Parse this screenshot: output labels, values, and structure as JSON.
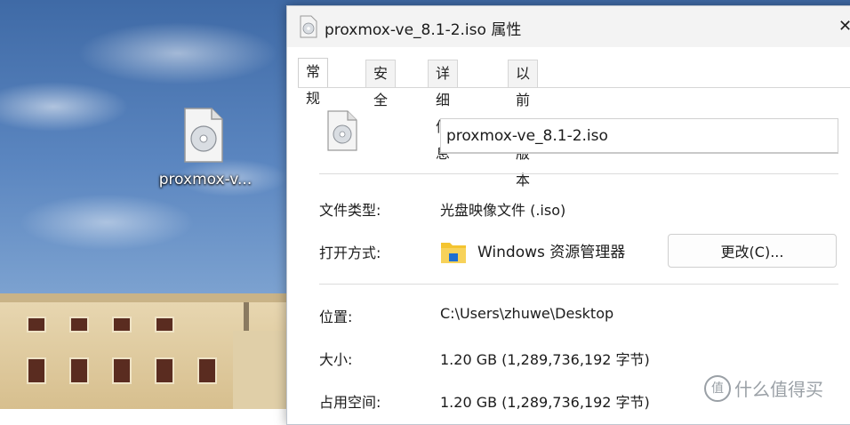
{
  "desktop": {
    "icon_label": "proxmox-v..."
  },
  "dialog": {
    "title": "proxmox-ve_8.1-2.iso 属性",
    "close_glyph": "✕",
    "tabs": [
      "常规",
      "安全",
      "详细信息",
      "以前的版本"
    ],
    "active_tab": "常规",
    "filename": "proxmox-ve_8.1-2.iso",
    "rows": {
      "file_type": {
        "label": "文件类型:",
        "value": "光盘映像文件 (.iso)"
      },
      "opens_with": {
        "label": "打开方式:",
        "app": "Windows 资源管理器",
        "button": "更改(C)..."
      },
      "location": {
        "label": "位置:",
        "value": "C:\\Users\\zhuwe\\Desktop"
      },
      "size": {
        "label": "大小:",
        "value": "1.20 GB (1,289,736,192 字节)"
      },
      "size_on_disk": {
        "label": "占用空间:",
        "value": "1.20 GB (1,289,736,192 字节)"
      }
    }
  },
  "watermark": {
    "mark": "值",
    "text": "什么值得买"
  },
  "icons": {
    "file": "disc-file-icon",
    "folder": "folder-icon",
    "close": "close-icon"
  },
  "colors": {
    "folder_yellow": "#f4c430",
    "folder_blue": "#1f6fd1"
  }
}
